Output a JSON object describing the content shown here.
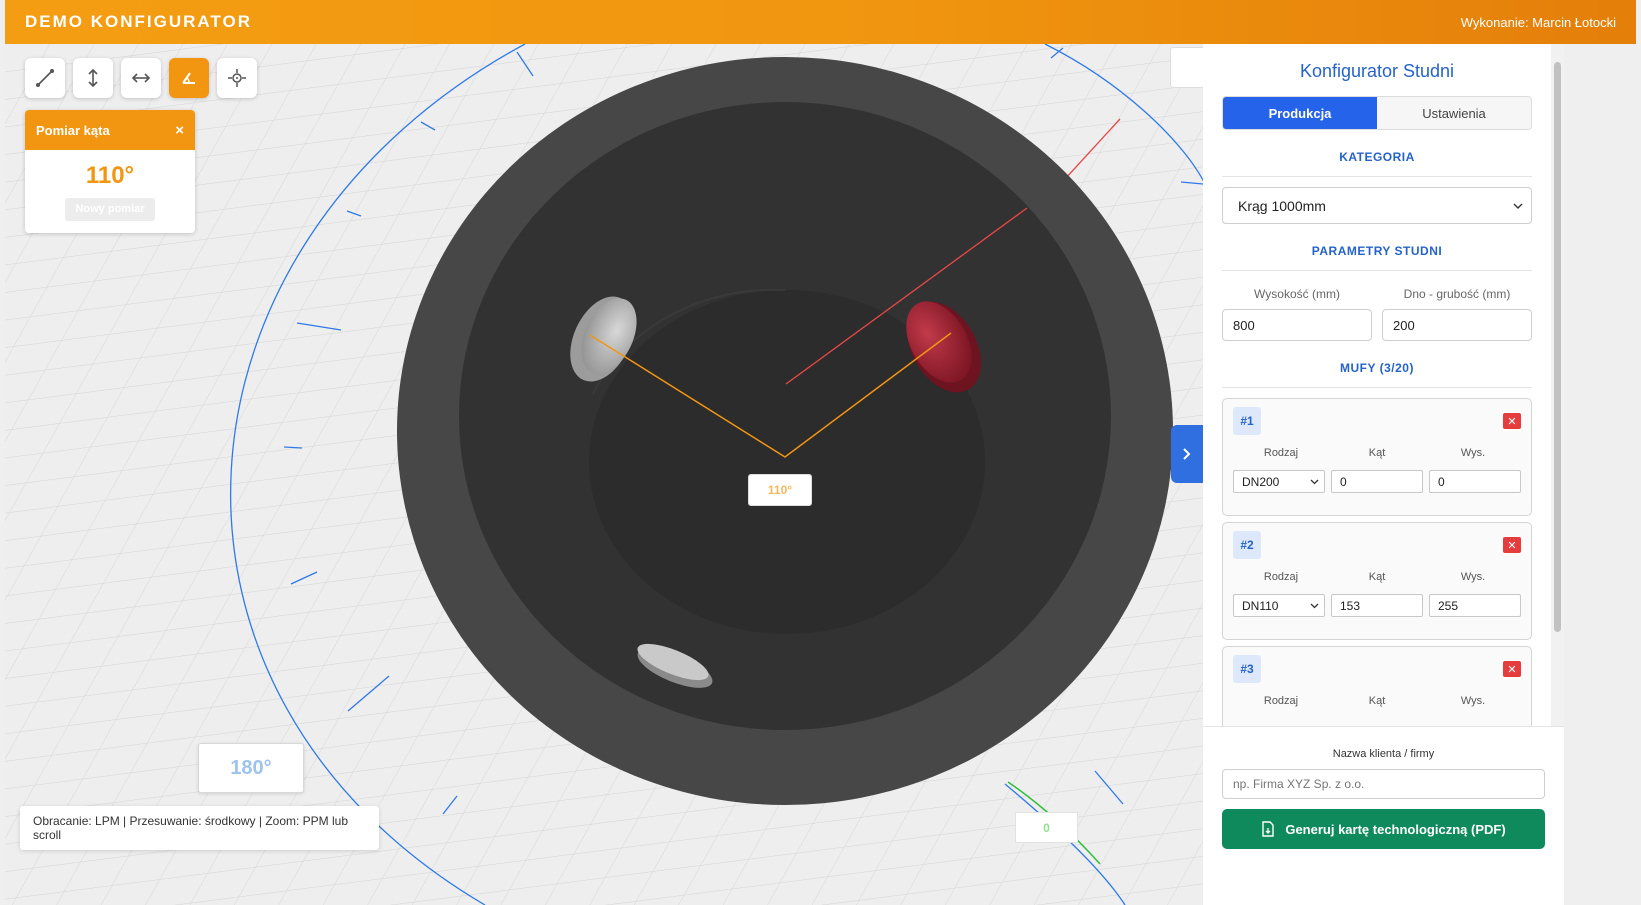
{
  "header": {
    "brand": "DEMO KONFIGURATOR",
    "author": "Wykonanie: Marcin Łotocki"
  },
  "toolbar": {
    "tools": [
      "line-measure-icon",
      "vertical-measure-icon",
      "horizontal-measure-icon",
      "angle-measure-icon",
      "crosshair-icon"
    ],
    "active": "angle-measure-icon"
  },
  "angle_panel": {
    "title": "Pomiar kąta",
    "close": "×",
    "value": "110°",
    "new_button": "Nowy pomiar"
  },
  "scene": {
    "angle_label": "110°",
    "compass_label": "180°",
    "zero_label": "0"
  },
  "hint": "Obracanie: LPM | Przesuwanie: środkowy | Zoom: PPM lub scroll",
  "panel": {
    "title": "Konfigurator Studni",
    "tabs": [
      "Produkcja",
      "Ustawienia"
    ],
    "category_title": "KATEGORIA",
    "category_value": "Krąg 1000mm",
    "params_title": "PARAMETRY STUDNI",
    "height_label": "Wysokość (mm)",
    "height_value": "800",
    "bottom_label": "Dno - grubość (mm)",
    "bottom_value": "200",
    "muffs_title": "MUFY (3/20)",
    "col_type": "Rodzaj",
    "col_angle": "Kąt",
    "col_height": "Wys.",
    "muffs": [
      {
        "num": "#1",
        "type": "DN200",
        "angle": "0",
        "height": "0"
      },
      {
        "num": "#2",
        "type": "DN110",
        "angle": "153",
        "height": "255"
      },
      {
        "num": "#3",
        "type": "",
        "angle": "",
        "height": ""
      }
    ]
  },
  "bottom": {
    "client_label": "Nazwa klienta / firmy",
    "client_placeholder": "np. Firma XYZ Sp. z o.o.",
    "pdf_button": "Generuj kartę technologiczną (PDF)"
  },
  "colors": {
    "accent": "#f29612",
    "primary": "#2563eb",
    "success": "#0f8a5c",
    "delete": "#e53d3d"
  }
}
